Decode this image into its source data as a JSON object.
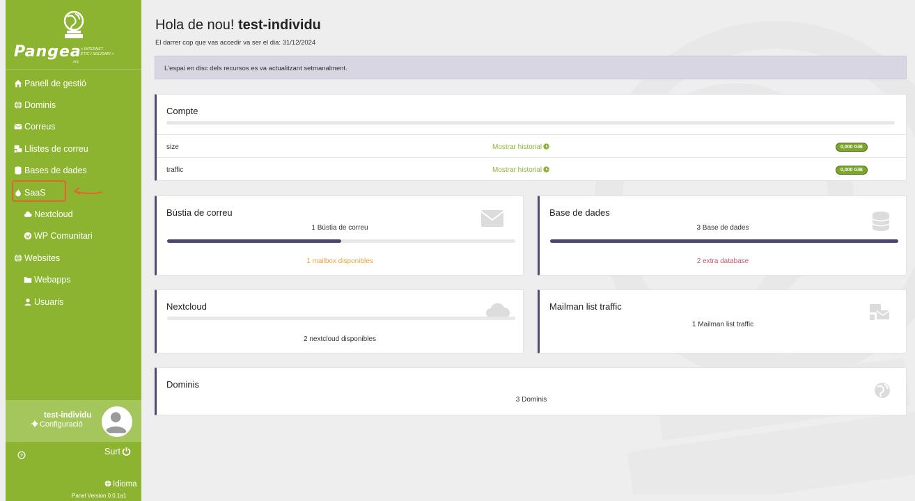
{
  "brand": {
    "name": "Pangea",
    "tagline_1": "< INTERNET",
    "tagline_2": "ÈTIC I SOLIDARI >",
    "suffix": ".org"
  },
  "nav": [
    {
      "label": "Panell de gestió",
      "icon": "home-icon"
    },
    {
      "label": "Dominis",
      "icon": "globe-icon"
    },
    {
      "label": "Correus",
      "icon": "envelope-icon"
    },
    {
      "label": "Llistes de correu",
      "icon": "mail-list-icon"
    },
    {
      "label": "Bases de dades",
      "icon": "database-icon"
    },
    {
      "label": "SaaS",
      "icon": "fire-icon",
      "highlighted": true
    },
    {
      "label": "Nextcloud",
      "icon": "cloud-icon",
      "sub": true
    },
    {
      "label": "WP Comunitari",
      "icon": "wordpress-icon",
      "sub": true
    },
    {
      "label": "Websites",
      "icon": "globe-icon"
    },
    {
      "label": "Webapps",
      "icon": "folder-icon",
      "sub": true
    },
    {
      "label": "Usuaris",
      "icon": "user-icon",
      "sub": true
    }
  ],
  "user": {
    "name": "test-individu",
    "config_label": "Configuració"
  },
  "footer": {
    "logout_label": "Surt",
    "language_label": "Idioma",
    "version": "Panel Version 0.0.1a1"
  },
  "header": {
    "greeting": "Hola de nou!",
    "username": "test-individu",
    "last_access": "El darrer cop que vas accedir va ser el dia: 31/12/2024"
  },
  "alert": "L'espai en disc dels recursos es va actualitzant setmanalment.",
  "compte": {
    "title": "Compte",
    "rows": [
      {
        "label": "size",
        "link": "Mostrar historial",
        "value": "0,000 GiB"
      },
      {
        "label": "traffic",
        "link": "Mostrar historial",
        "value": "0,000 GiB"
      }
    ]
  },
  "cards": {
    "mailbox": {
      "title": "Bústia de correu",
      "subtitle": "1 Bústia de correu",
      "progress": 0.5,
      "footer": "1 mailbox disponibles",
      "icon": "envelope-icon"
    },
    "database": {
      "title": "Base de dades",
      "subtitle": "3 Base de dades",
      "progress": 1.0,
      "footer": "2 extra database",
      "icon": "database-icon"
    },
    "nextcloud": {
      "title": "Nextcloud",
      "progress": 0.0,
      "footer": "2 nextcloud disponibles",
      "icon": "cloud-icon"
    },
    "mailman": {
      "title": "Mailman list traffic",
      "subtitle": "1 Mailman list traffic",
      "icon": "mail-list-icon"
    },
    "dominis": {
      "title": "Dominis",
      "subtitle": "3 Dominis",
      "icon": "globe-icon"
    }
  },
  "colors": {
    "sidebar": "#8cb431",
    "accent_bar": "#4f4a73",
    "link_green": "#8cb431",
    "orange_text": "#e8a33c",
    "red_text": "#c05a6a",
    "highlight": "#e8622c"
  }
}
